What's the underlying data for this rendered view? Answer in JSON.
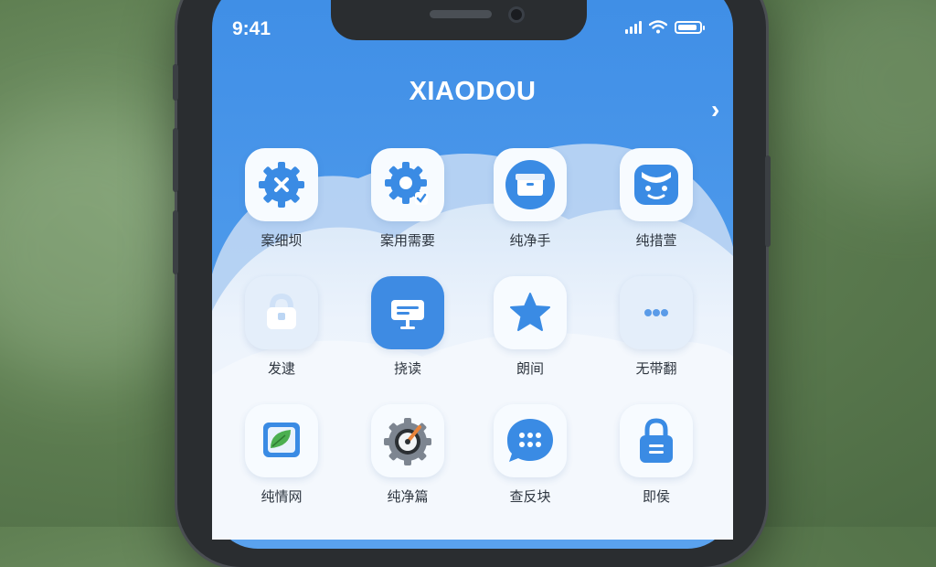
{
  "status_bar": {
    "time": "9:41"
  },
  "header": {
    "title": "XIAODOU"
  },
  "grid": [
    {
      "label": "案细坝",
      "icon": "gear-x-icon"
    },
    {
      "label": "案用需要",
      "icon": "gear-check-icon"
    },
    {
      "label": "纯净手",
      "icon": "box-icon"
    },
    {
      "label": "纯措萱",
      "icon": "face-icon"
    },
    {
      "label": "发逮",
      "icon": "bag-icon"
    },
    {
      "label": "挠读",
      "icon": "screen-icon"
    },
    {
      "label": "朗间",
      "icon": "star-icon"
    },
    {
      "label": "无带翻",
      "icon": "dots-icon"
    },
    {
      "label": "纯情网",
      "icon": "leaf-icon"
    },
    {
      "label": "纯净篇",
      "icon": "compass-gear-icon"
    },
    {
      "label": "查反块",
      "icon": "chat-icon"
    },
    {
      "label": "即侯",
      "icon": "lock-icon"
    }
  ],
  "colors": {
    "accent": "#3e8be3",
    "header_bg": "#4a97ea"
  }
}
